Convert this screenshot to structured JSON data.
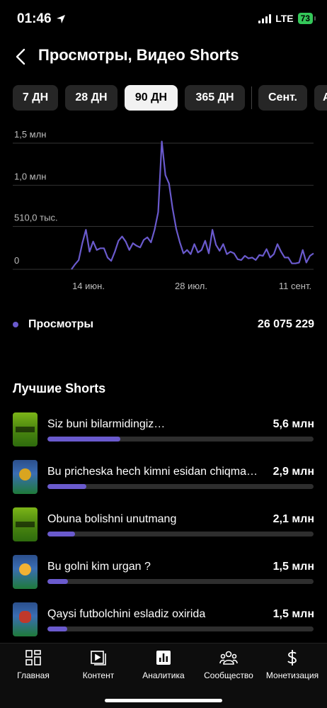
{
  "status_bar": {
    "time": "01:46",
    "network": "LTE",
    "battery": "73"
  },
  "header": {
    "title": "Просмотры, Видео Shorts"
  },
  "periods": [
    {
      "label": "7 ДН",
      "active": false
    },
    {
      "label": "28 ДН",
      "active": false
    },
    {
      "label": "90 ДН",
      "active": true
    },
    {
      "label": "365 ДН",
      "active": false
    },
    {
      "label": "Сент.",
      "active": false
    },
    {
      "label": "А",
      "active": false
    }
  ],
  "chart_data": {
    "type": "line",
    "title": "",
    "xlabel": "",
    "ylabel": "",
    "y_ticks": [
      "1,5 млн",
      "1,0 млн",
      "510,0 тыс.",
      "0"
    ],
    "x_ticks": [
      "14 июн.",
      "28 июл.",
      "11 сент."
    ],
    "ylim": [
      0,
      1500000
    ],
    "grid": true,
    "color": "#6a5acd",
    "series": [
      {
        "values": [
          0,
          60000,
          110000,
          310000,
          470000,
          210000,
          330000,
          230000,
          250000,
          250000,
          140000,
          100000,
          210000,
          340000,
          390000,
          330000,
          230000,
          310000,
          280000,
          260000,
          350000,
          380000,
          320000,
          470000,
          680000,
          1520000,
          1120000,
          1020000,
          720000,
          480000,
          320000,
          190000,
          230000,
          180000,
          300000,
          200000,
          230000,
          340000,
          190000,
          470000,
          290000,
          220000,
          300000,
          180000,
          210000,
          190000,
          120000,
          110000,
          160000,
          130000,
          140000,
          110000,
          170000,
          160000,
          240000,
          140000,
          180000,
          300000,
          210000,
          140000,
          140000,
          70000,
          70000,
          80000,
          230000,
          80000,
          160000,
          190000
        ]
      }
    ]
  },
  "legend": {
    "label": "Просмотры",
    "total": "26 075 229"
  },
  "top_shorts": {
    "title": "Лучшие Shorts",
    "items": [
      {
        "name": "Siz buni bilarmidingiz…",
        "views": "5,6 млн",
        "share": 0.275,
        "thumb": "green"
      },
      {
        "name": "Bu pricheska hech kimni esidan chiqma…",
        "views": "2,9 млн",
        "share": 0.145,
        "thumb": "blue"
      },
      {
        "name": "Obuna bolishni unutmang",
        "views": "2,1 млн",
        "share": 0.105,
        "thumb": "green"
      },
      {
        "name": "Bu golni kim urgan ?",
        "views": "1,5 млн",
        "share": 0.076,
        "thumb": "blue-emoji"
      },
      {
        "name": "Qaysi futbolchini esladiz oxirida",
        "views": "1,5 млн",
        "share": 0.074,
        "thumb": "blue"
      }
    ]
  },
  "nav": {
    "items": [
      {
        "label": "Главная",
        "icon": "home-grid-icon"
      },
      {
        "label": "Контент",
        "icon": "content-play-icon"
      },
      {
        "label": "Аналитика",
        "icon": "analytics-bars-icon"
      },
      {
        "label": "Сообщество",
        "icon": "community-people-icon"
      },
      {
        "label": "Монетизация",
        "icon": "dollar-icon"
      }
    ]
  }
}
